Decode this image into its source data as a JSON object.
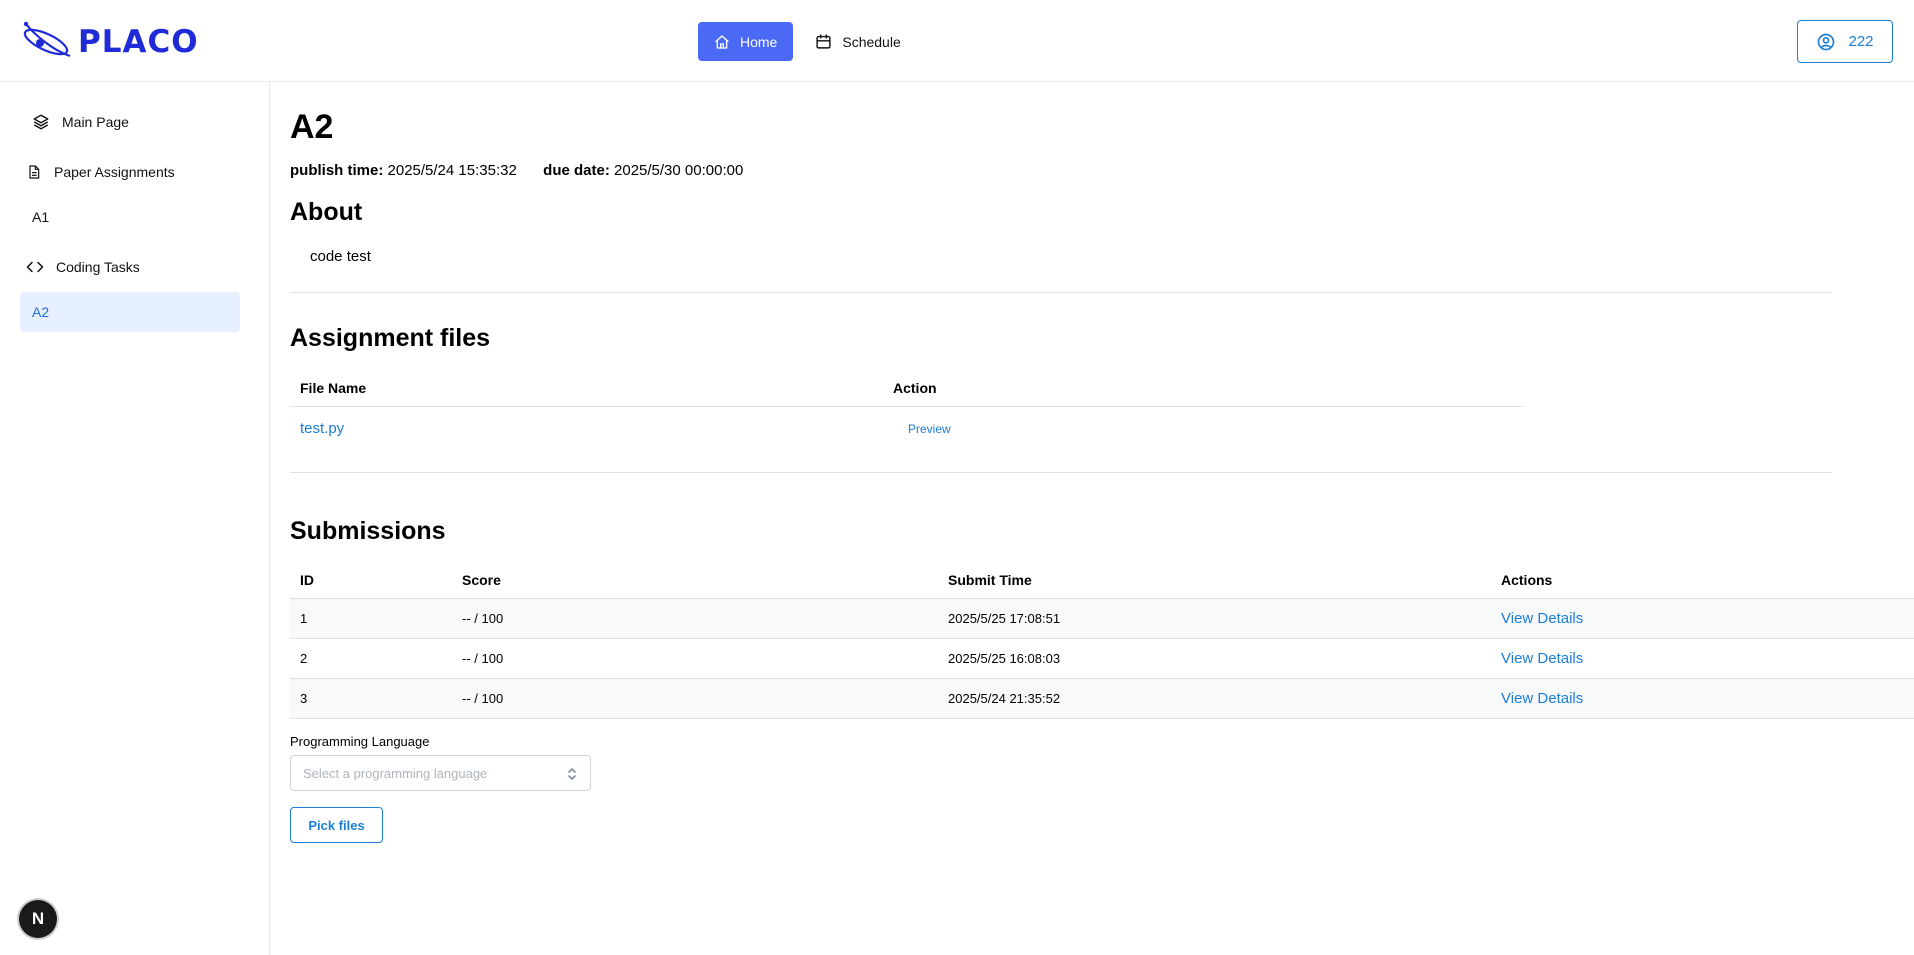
{
  "brand": {
    "name": "PLACO",
    "color": "#1f2bd8"
  },
  "nav": {
    "home": {
      "label": "Home",
      "icon": "home-icon"
    },
    "schedule": {
      "label": "Schedule",
      "icon": "calendar-icon"
    }
  },
  "user": {
    "label": "222",
    "icon": "user-circle-icon"
  },
  "sidebar": {
    "items": [
      {
        "label": "Main Page",
        "icon": "layers-icon"
      },
      {
        "label": "Paper Assignments",
        "icon": "document-icon"
      },
      {
        "label": "A1"
      },
      {
        "label": "Coding Tasks",
        "icon": "code-icon"
      },
      {
        "label": "A2",
        "active": true
      }
    ],
    "badge": "N"
  },
  "assignment": {
    "title": "A2",
    "publish_label": "publish time:",
    "publish_value": "2025/5/24 15:35:32",
    "due_label": "due date:",
    "due_value": "2025/5/30 00:00:00",
    "about_heading": "About",
    "about_text": "code test"
  },
  "files": {
    "heading": "Assignment files",
    "columns": [
      "File Name",
      "Action"
    ],
    "rows": [
      {
        "name": "test.py",
        "action": "Preview"
      }
    ]
  },
  "submissions": {
    "heading": "Submissions",
    "columns": [
      "ID",
      "Score",
      "Submit Time",
      "Actions"
    ],
    "rows": [
      {
        "id": "1",
        "score": "-- / 100",
        "time": "2025/5/25 17:08:51",
        "action": "View Details"
      },
      {
        "id": "2",
        "score": "-- / 100",
        "time": "2025/5/25 16:08:03",
        "action": "View Details"
      },
      {
        "id": "3",
        "score": "-- / 100",
        "time": "2025/5/24 21:35:52",
        "action": "View Details"
      }
    ]
  },
  "form": {
    "lang_label": "Programming Language",
    "lang_placeholder": "Select a programming language",
    "pick_label": "Pick files"
  },
  "colors": {
    "accent": "#4a69f5",
    "link": "#1c7ed6",
    "active_bg": "#e7f0fe"
  }
}
